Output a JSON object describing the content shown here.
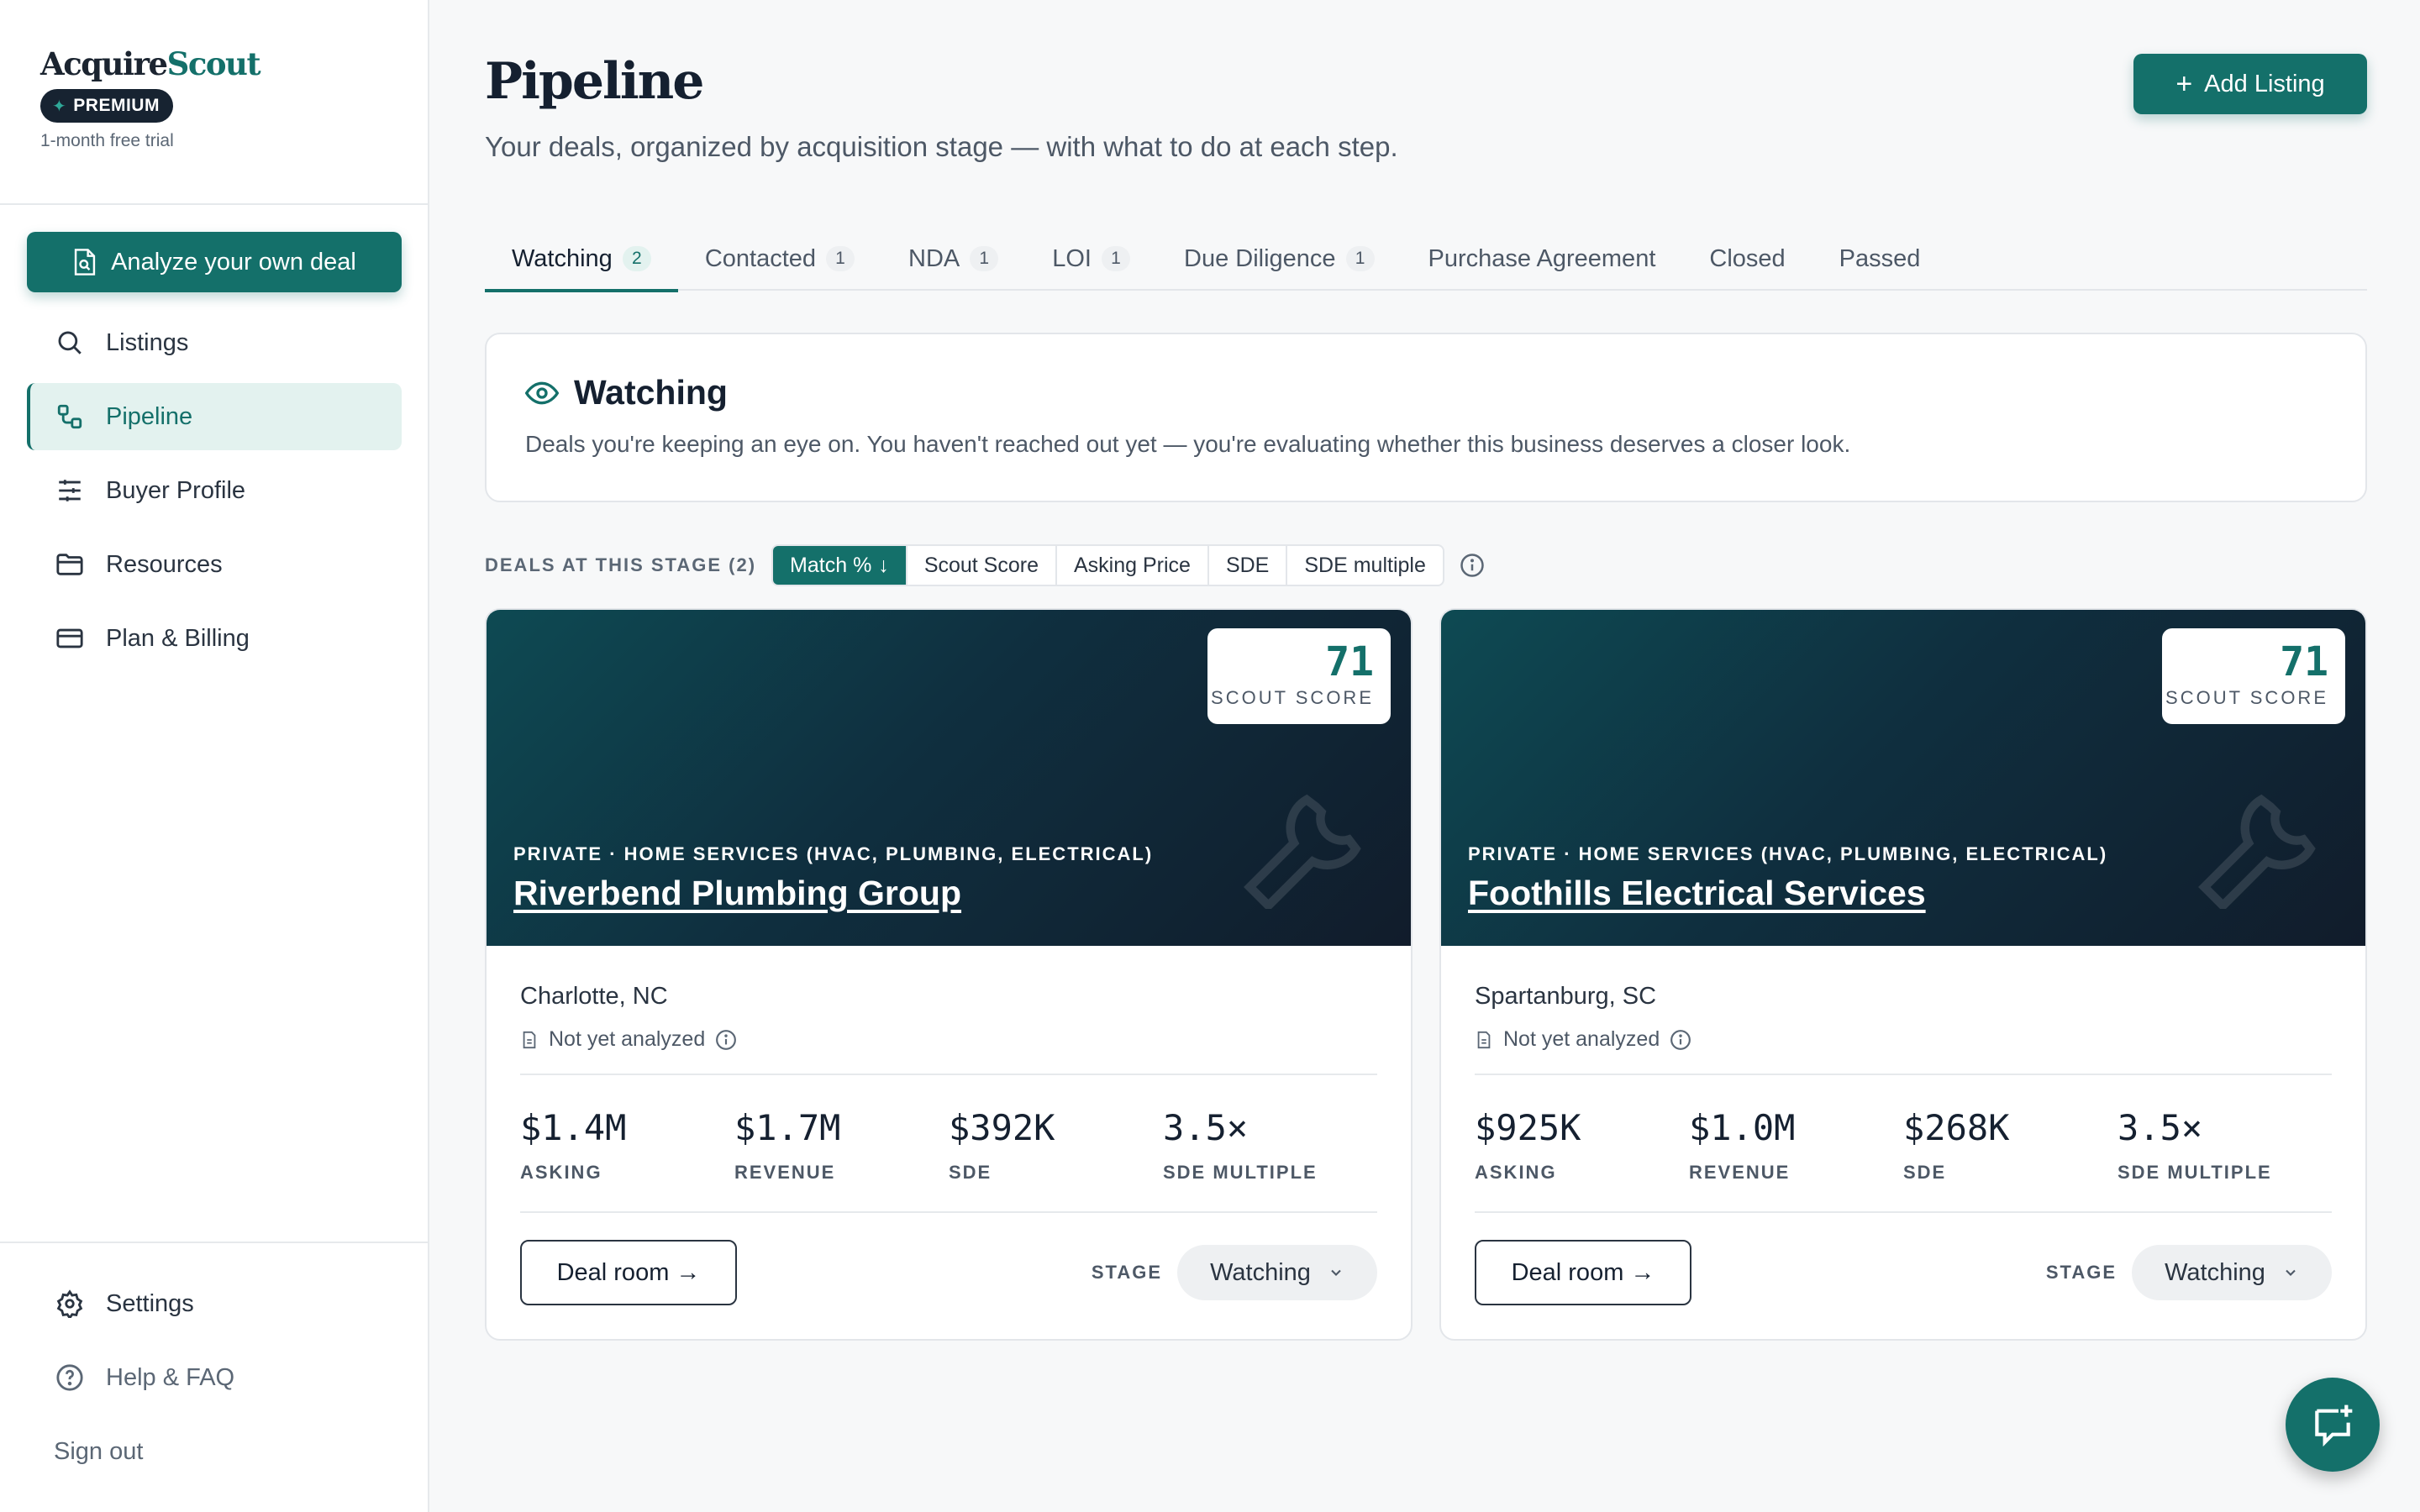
{
  "brand": {
    "logo_part1": "Acquire",
    "logo_part2": "Scout",
    "badge": "PREMIUM",
    "trial": "1-month free trial"
  },
  "sidebar": {
    "analyze_label": "Analyze your own deal",
    "items": [
      {
        "label": "Listings",
        "icon": "search-icon"
      },
      {
        "label": "Pipeline",
        "icon": "pipeline-icon",
        "active": true
      },
      {
        "label": "Buyer Profile",
        "icon": "sliders-icon"
      },
      {
        "label": "Resources",
        "icon": "folder-icon"
      },
      {
        "label": "Plan & Billing",
        "icon": "credit-card-icon"
      }
    ],
    "bottom": [
      {
        "label": "Settings",
        "icon": "gear-icon"
      },
      {
        "label": "Help & FAQ",
        "icon": "help-icon"
      }
    ],
    "signout": "Sign out"
  },
  "header": {
    "title": "Pipeline",
    "subtitle": "Your deals, organized by acquisition stage — with what to do at each step.",
    "add_label": "Add Listing"
  },
  "tabs": [
    {
      "label": "Watching",
      "count": "2",
      "active": true
    },
    {
      "label": "Contacted",
      "count": "1"
    },
    {
      "label": "NDA",
      "count": "1"
    },
    {
      "label": "LOI",
      "count": "1"
    },
    {
      "label": "Due Diligence",
      "count": "1"
    },
    {
      "label": "Purchase Agreement",
      "count": ""
    },
    {
      "label": "Closed",
      "count": ""
    },
    {
      "label": "Passed",
      "count": ""
    }
  ],
  "stage_card": {
    "title": "Watching",
    "description": "Deals you're keeping an eye on. You haven't reached out yet — you're evaluating whether this business deserves a closer look."
  },
  "sort": {
    "label": "DEALS AT THIS STAGE (2)",
    "options": [
      "Match %",
      "Scout Score",
      "Asking Price",
      "SDE",
      "SDE multiple"
    ],
    "active": "Match %"
  },
  "deals": [
    {
      "score": "71",
      "score_label": "SCOUT SCORE",
      "category": "PRIVATE · HOME SERVICES (HVAC, PLUMBING, ELECTRICAL)",
      "name": "Riverbend Plumbing Group",
      "location": "Charlotte, NC",
      "analysis": "Not yet analyzed",
      "metrics": [
        {
          "value": "$1.4M",
          "label": "ASKING"
        },
        {
          "value": "$1.7M",
          "label": "REVENUE"
        },
        {
          "value": "$392K",
          "label": "SDE"
        },
        {
          "value": "3.5×",
          "label": "SDE MULTIPLE"
        }
      ],
      "dealroom": "Deal room →",
      "stage_label": "STAGE",
      "stage_value": "Watching"
    },
    {
      "score": "71",
      "score_label": "SCOUT SCORE",
      "category": "PRIVATE · HOME SERVICES (HVAC, PLUMBING, ELECTRICAL)",
      "name": "Foothills Electrical Services",
      "location": "Spartanburg, SC",
      "analysis": "Not yet analyzed",
      "metrics": [
        {
          "value": "$925K",
          "label": "ASKING"
        },
        {
          "value": "$1.0M",
          "label": "REVENUE"
        },
        {
          "value": "$268K",
          "label": "SDE"
        },
        {
          "value": "3.5×",
          "label": "SDE MULTIPLE"
        }
      ],
      "dealroom": "Deal room →",
      "stage_label": "STAGE",
      "stage_value": "Watching"
    }
  ],
  "colors": {
    "accent": "#14706a",
    "dark": "#172331",
    "active_bg": "#e3f2ef"
  }
}
